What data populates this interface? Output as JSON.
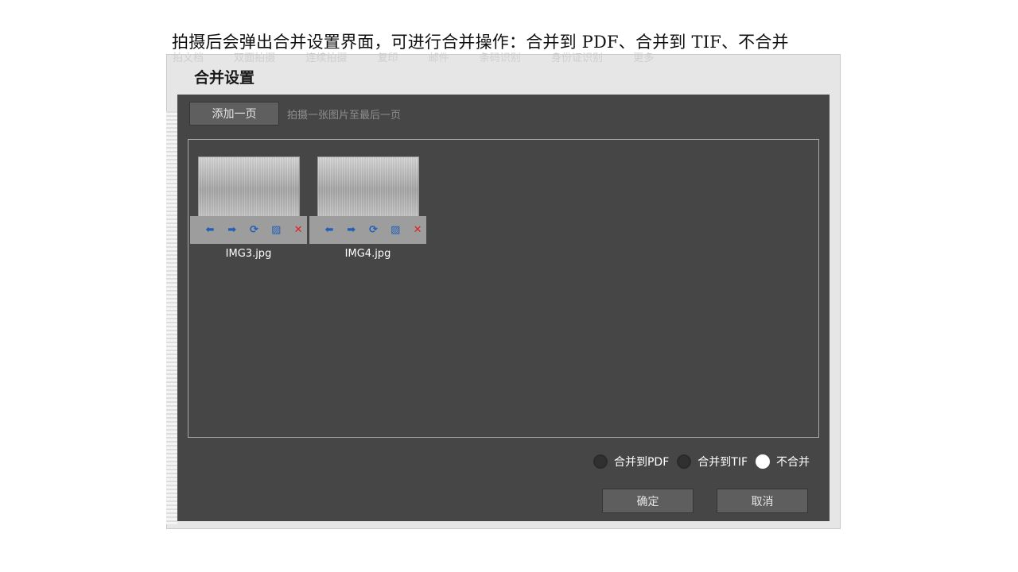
{
  "caption": "拍摄后会弹出合并设置界面，可进行合并操作：合并到 PDF、合并到 TIF、不合并",
  "background_tabs": [
    "拍文档",
    "双面拍摄",
    "连续拍摄",
    "复印",
    "邮件",
    "条码识别",
    "身份证识别",
    "更多"
  ],
  "dialog": {
    "title": "合并设置",
    "add_page_label": "添加一页",
    "hint": "拍摄一张图片至最后一页",
    "thumbnails": [
      {
        "filename": "IMG3.jpg"
      },
      {
        "filename": "IMG4.jpg"
      }
    ],
    "thumb_icons": [
      "arrow-left-icon",
      "arrow-right-icon",
      "rotate-icon",
      "edit-icon",
      "delete-icon"
    ],
    "merge_options": [
      {
        "label": "合并到PDF",
        "selected": false
      },
      {
        "label": "合并到TIF",
        "selected": false
      },
      {
        "label": "不合并",
        "selected": true
      }
    ],
    "ok_label": "确定",
    "cancel_label": "取消"
  },
  "colors": {
    "dialog_bg": "#464646",
    "icon_blue": "#1f5fb8",
    "icon_red": "#e81e1e"
  }
}
